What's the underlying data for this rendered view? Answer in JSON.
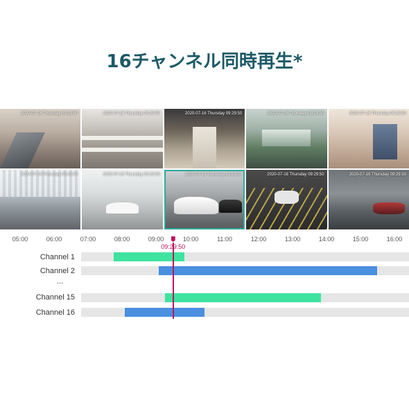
{
  "title": "16チャンネル同時再生*",
  "colors": {
    "title": "#1c5a66",
    "green": "#3ee3a0",
    "blue": "#4a8fe0",
    "cursor": "#c0135f",
    "selected": "#2fa89e"
  },
  "thumbnails": [
    {
      "ts": "2020-07-16 Thursday 09:29:50",
      "selected": false
    },
    {
      "ts": "2020-07-16 Thursday 09:29:50",
      "selected": false
    },
    {
      "ts": "2020-07-16 Thursday 09:29:50",
      "selected": false
    },
    {
      "ts": "2020-07-16 Thursday 09:29:50",
      "selected": false
    },
    {
      "ts": "2020-07-16 Thursday 09:29:50",
      "selected": false
    },
    {
      "ts": "2020-07-16 Thursday 09:29:50",
      "selected": false
    },
    {
      "ts": "2020-07-16 Thursday 09:29:50",
      "selected": false
    },
    {
      "ts": "2020-07-16 Thursday 09:29:50",
      "selected": true
    },
    {
      "ts": "2020-07-16 Thursday 09:29:50",
      "selected": false
    },
    {
      "ts": "2020-07-16 Thursday 09:29:50",
      "selected": false
    }
  ],
  "timeline": {
    "ticks": [
      "05:00",
      "06:00",
      "07:00",
      "08:00",
      "09:00",
      "10:00",
      "11:00",
      "12:00",
      "13:00",
      "14:00",
      "15:00",
      "16:00"
    ],
    "cursor_time": "09:29:50",
    "channels": [
      {
        "label": "Channel 1",
        "start": "07:45",
        "end": "09:50",
        "color": "green"
      },
      {
        "label": "Channel 2",
        "start": "09:05",
        "end": "15:30",
        "color": "blue"
      },
      {
        "label": "Channel 15",
        "start": "09:15",
        "end": "13:50",
        "color": "green"
      },
      {
        "label": "Channel 16",
        "start": "08:05",
        "end": "10:25",
        "color": "blue"
      }
    ],
    "ellipsis": "..."
  }
}
